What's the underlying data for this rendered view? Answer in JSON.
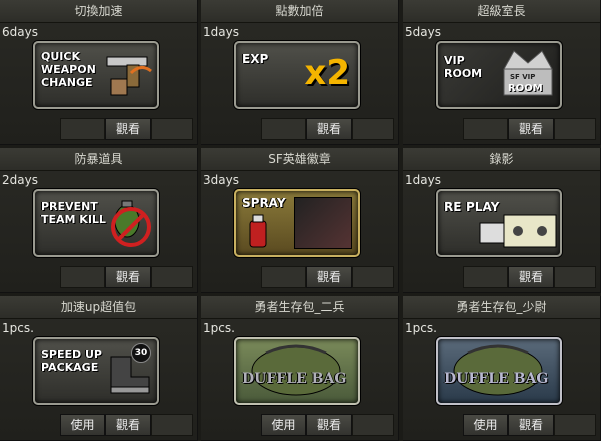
{
  "items": [
    {
      "title": "切換加速",
      "qty": "6days",
      "card_lines": [
        "QUICK",
        "WEAPON",
        "CHANGE"
      ],
      "buttons": [
        "觀看"
      ]
    },
    {
      "title": "點數加倍",
      "qty": "1days",
      "card_lines": [
        "EXP"
      ],
      "badge": "x2",
      "buttons": [
        "觀看"
      ]
    },
    {
      "title": "超級室長",
      "qty": "5days",
      "card_lines": [
        "VIP",
        "ROOM"
      ],
      "badge": "SF VIP",
      "badge2": "ROOM",
      "buttons": [
        "觀看"
      ]
    },
    {
      "title": "防暴道具",
      "qty": "2days",
      "card_lines": [
        "PREVENT",
        "TEAM KILL"
      ],
      "buttons": [
        "觀看"
      ]
    },
    {
      "title": "SF英雄徽章",
      "qty": "3days",
      "card_lines": [
        "SPRAY"
      ],
      "buttons": [
        "觀看"
      ]
    },
    {
      "title": "錄影",
      "qty": "1days",
      "card_lines": [
        "RE",
        "PLAY"
      ],
      "buttons": [
        "觀看"
      ]
    },
    {
      "title": "加速up超值包",
      "qty": "1pcs.",
      "card_lines": [
        "SPEED UP",
        "PACKAGE"
      ],
      "badge": "30",
      "buttons": [
        "使用",
        "觀看"
      ]
    },
    {
      "title": "勇者生存包_二兵",
      "qty": "1pcs.",
      "card_lines": [
        "DUFFLE BAG"
      ],
      "buttons": [
        "使用",
        "觀看"
      ]
    },
    {
      "title": "勇者生存包_少尉",
      "qty": "1pcs.",
      "card_lines": [
        "DUFFLE BAG"
      ],
      "buttons": [
        "使用",
        "觀看"
      ]
    }
  ],
  "colors": {
    "accent": "#f5c400",
    "danger": "#e03030",
    "bg": "#1b1b17"
  }
}
